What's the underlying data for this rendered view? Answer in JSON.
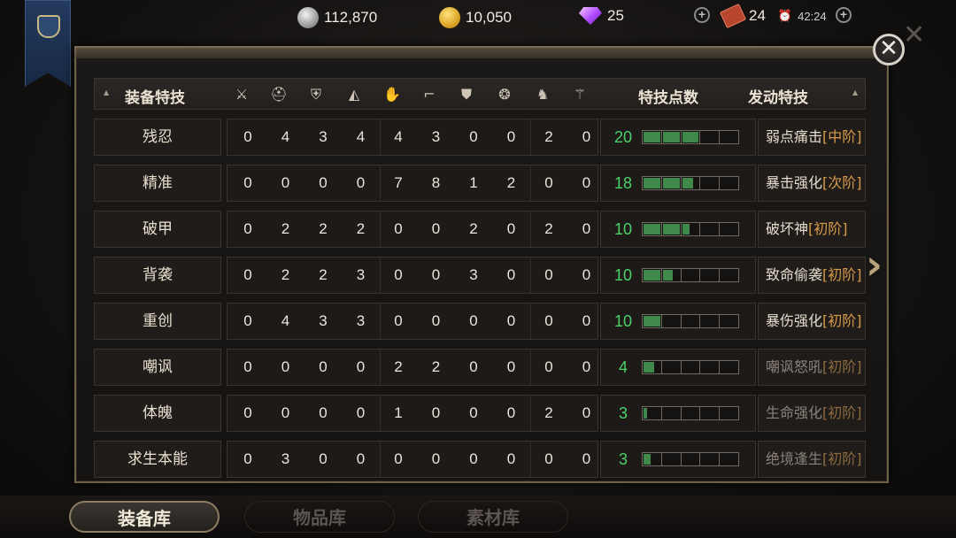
{
  "currencies": [
    {
      "icon": "silver-coin-icon",
      "value": "112,870"
    },
    {
      "icon": "gold-coin-icon",
      "value": "10,050"
    },
    {
      "icon": "diamond-icon",
      "value": "25"
    },
    {
      "icon": "ticket-icon",
      "value": "24"
    }
  ],
  "timer": "42:24",
  "table": {
    "header": {
      "left": "装备特技",
      "equipment_icons": [
        "sword-icon",
        "helmet-icon",
        "armor-icon",
        "shoulder-icon",
        "glove-icon",
        "boots-icon",
        "shield-icon",
        "amulet-icon",
        "horse-icon",
        "trinket-icon"
      ],
      "points": "特技点数",
      "trigger": "发动特技"
    },
    "rows": [
      {
        "name": "残忍",
        "values": [
          "0",
          "4",
          "3",
          "4",
          "4",
          "3",
          "0",
          "0",
          "2",
          "0"
        ],
        "points": "20",
        "fill": 0.6,
        "trigger": "弱点痛击",
        "level": "[中阶]",
        "dim": false
      },
      {
        "name": "精准",
        "values": [
          "0",
          "0",
          "0",
          "0",
          "7",
          "8",
          "1",
          "2",
          "0",
          "0"
        ],
        "points": "18",
        "fill": 0.54,
        "trigger": "暴击强化",
        "level": "[次阶]",
        "dim": false
      },
      {
        "name": "破甲",
        "values": [
          "0",
          "2",
          "2",
          "2",
          "0",
          "0",
          "2",
          "0",
          "2",
          "0"
        ],
        "points": "10",
        "fill": 0.5,
        "trigger": "破坏神",
        "level": "[初阶]",
        "dim": false
      },
      {
        "name": "背袭",
        "values": [
          "0",
          "2",
          "2",
          "3",
          "0",
          "0",
          "3",
          "0",
          "0",
          "0"
        ],
        "points": "10",
        "fill": 0.33,
        "trigger": "致命偷袭",
        "level": "[初阶]",
        "dim": false
      },
      {
        "name": "重创",
        "values": [
          "0",
          "4",
          "3",
          "3",
          "0",
          "0",
          "0",
          "0",
          "0",
          "0"
        ],
        "points": "10",
        "fill": 0.2,
        "trigger": "暴伤强化",
        "level": "[初阶]",
        "dim": false
      },
      {
        "name": "嘲讽",
        "values": [
          "0",
          "0",
          "0",
          "0",
          "2",
          "2",
          "0",
          "0",
          "0",
          "0"
        ],
        "points": "4",
        "fill": 0.13,
        "trigger": "嘲讽怒吼",
        "level": "[初阶]",
        "dim": true
      },
      {
        "name": "体魄",
        "values": [
          "0",
          "0",
          "0",
          "0",
          "1",
          "0",
          "0",
          "0",
          "2",
          "0"
        ],
        "points": "3",
        "fill": 0.06,
        "trigger": "生命强化",
        "level": "[初阶]",
        "dim": true
      },
      {
        "name": "求生本能",
        "values": [
          "0",
          "3",
          "0",
          "0",
          "0",
          "0",
          "0",
          "0",
          "0",
          "0"
        ],
        "points": "3",
        "fill": 0.1,
        "trigger": "绝境逢生",
        "level": "[初阶]",
        "dim": true
      }
    ]
  },
  "tabs": [
    {
      "label": "装备库",
      "active": true
    },
    {
      "label": "物品库",
      "active": false
    },
    {
      "label": "素材库",
      "active": false
    }
  ],
  "colors": {
    "points_green": "#4cd16a",
    "level_orange": "#d79a4a",
    "bar_fill": "#3f8a4a"
  }
}
